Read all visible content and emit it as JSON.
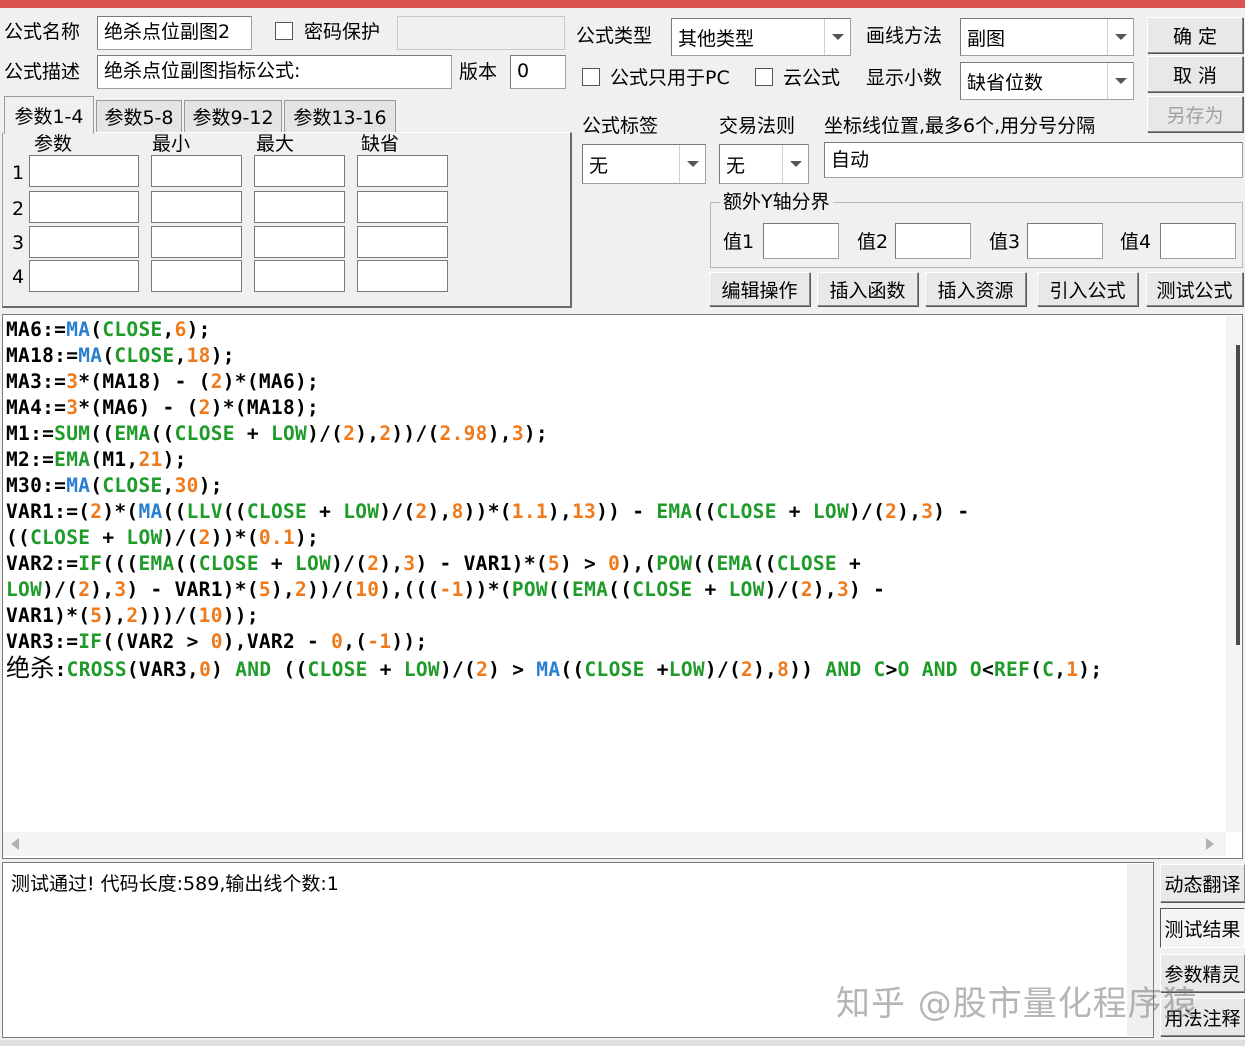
{
  "header": {
    "formula_name_label": "公式名称",
    "formula_name_value": "绝杀点位副图2",
    "password_label": "密码保护",
    "formula_type_label": "公式类型",
    "formula_type_value": "其他类型",
    "draw_method_label": "画线方法",
    "draw_method_value": "副图",
    "formula_desc_label": "公式描述",
    "formula_desc_value": "绝杀点位副图指标公式:",
    "version_label": "版本",
    "version_value": "0",
    "pc_only_label": "公式只用于PC",
    "cloud_label": "云公式",
    "decimals_label": "显示小数",
    "decimals_value": "缺省位数"
  },
  "buttons": {
    "ok": "确 定",
    "cancel": "取 消",
    "save_as": "另存为",
    "edit_ops": "编辑操作",
    "insert_func": "插入函数",
    "insert_resource": "插入资源",
    "import_formula": "引入公式",
    "test_formula": "测试公式"
  },
  "tabs": [
    "参数1-4",
    "参数5-8",
    "参数9-12",
    "参数13-16"
  ],
  "params": {
    "headers": [
      "参数",
      "最小",
      "最大",
      "缺省"
    ],
    "rows": [
      "1",
      "2",
      "3",
      "4"
    ]
  },
  "tags": {
    "formula_tag_label": "公式标签",
    "formula_tag_value": "无",
    "trade_rule_label": "交易法则",
    "trade_rule_value": "无",
    "axis_label": "坐标线位置,最多6个,用分号分隔",
    "axis_value": "自动"
  },
  "yaxis": {
    "group_label": "额外Y轴分界",
    "labels": [
      "值1",
      "值2",
      "值3",
      "值4"
    ]
  },
  "code_lines": [
    [
      [
        "k",
        "MA6:="
      ],
      [
        "m",
        "MA"
      ],
      [
        "k",
        "("
      ],
      [
        "f",
        "CLOSE"
      ],
      [
        "k",
        ","
      ],
      [
        "n",
        "6"
      ],
      [
        "k",
        ");"
      ]
    ],
    [
      [
        "k",
        "MA18:="
      ],
      [
        "m",
        "MA"
      ],
      [
        "k",
        "("
      ],
      [
        "f",
        "CLOSE"
      ],
      [
        "k",
        ","
      ],
      [
        "n",
        "18"
      ],
      [
        "k",
        ");"
      ]
    ],
    [
      [
        "k",
        "MA3:="
      ],
      [
        "n",
        "3"
      ],
      [
        "k",
        "*(MA18) - ("
      ],
      [
        "n",
        "2"
      ],
      [
        "k",
        ")*(MA6);"
      ]
    ],
    [
      [
        "k",
        "MA4:="
      ],
      [
        "n",
        "3"
      ],
      [
        "k",
        "*(MA6) - ("
      ],
      [
        "n",
        "2"
      ],
      [
        "k",
        ")*(MA18);"
      ]
    ],
    [
      [
        "k",
        "M1:="
      ],
      [
        "f",
        "SUM"
      ],
      [
        "k",
        "(("
      ],
      [
        "f",
        "EMA"
      ],
      [
        "k",
        "(("
      ],
      [
        "f",
        "CLOSE"
      ],
      [
        "k",
        " + "
      ],
      [
        "f",
        "LOW"
      ],
      [
        "k",
        ")/("
      ],
      [
        "n",
        "2"
      ],
      [
        "k",
        "),"
      ],
      [
        "n",
        "2"
      ],
      [
        "k",
        "))/("
      ],
      [
        "n",
        "2.98"
      ],
      [
        "k",
        "),"
      ],
      [
        "n",
        "3"
      ],
      [
        "k",
        ");"
      ]
    ],
    [
      [
        "k",
        "M2:="
      ],
      [
        "f",
        "EMA"
      ],
      [
        "k",
        "(M1,"
      ],
      [
        "n",
        "21"
      ],
      [
        "k",
        ");"
      ]
    ],
    [
      [
        "k",
        "M30:="
      ],
      [
        "m",
        "MA"
      ],
      [
        "k",
        "("
      ],
      [
        "f",
        "CLOSE"
      ],
      [
        "k",
        ","
      ],
      [
        "n",
        "30"
      ],
      [
        "k",
        ");"
      ]
    ],
    [
      [
        "k",
        "VAR1:=("
      ],
      [
        "n",
        "2"
      ],
      [
        "k",
        ")*("
      ],
      [
        "m",
        "MA"
      ],
      [
        "k",
        "(("
      ],
      [
        "f",
        "LLV"
      ],
      [
        "k",
        "(("
      ],
      [
        "f",
        "CLOSE"
      ],
      [
        "k",
        " + "
      ],
      [
        "f",
        "LOW"
      ],
      [
        "k",
        ")/("
      ],
      [
        "n",
        "2"
      ],
      [
        "k",
        "),"
      ],
      [
        "n",
        "8"
      ],
      [
        "k",
        "))*("
      ],
      [
        "n",
        "1.1"
      ],
      [
        "k",
        "),"
      ],
      [
        "n",
        "13"
      ],
      [
        "k",
        ")) - "
      ],
      [
        "f",
        "EMA"
      ],
      [
        "k",
        "(("
      ],
      [
        "f",
        "CLOSE"
      ],
      [
        "k",
        " + "
      ],
      [
        "f",
        "LOW"
      ],
      [
        "k",
        ")/("
      ],
      [
        "n",
        "2"
      ],
      [
        "k",
        "),"
      ],
      [
        "n",
        "3"
      ],
      [
        "k",
        ") -"
      ]
    ],
    [
      [
        "k",
        "(("
      ],
      [
        "f",
        "CLOSE"
      ],
      [
        "k",
        " + "
      ],
      [
        "f",
        "LOW"
      ],
      [
        "k",
        ")/("
      ],
      [
        "n",
        "2"
      ],
      [
        "k",
        "))*("
      ],
      [
        "n",
        "0.1"
      ],
      [
        "k",
        ");"
      ]
    ],
    [
      [
        "k",
        "VAR2:="
      ],
      [
        "f",
        "IF"
      ],
      [
        "k",
        "((("
      ],
      [
        "f",
        "EMA"
      ],
      [
        "k",
        "(("
      ],
      [
        "f",
        "CLOSE"
      ],
      [
        "k",
        " + "
      ],
      [
        "f",
        "LOW"
      ],
      [
        "k",
        ")/("
      ],
      [
        "n",
        "2"
      ],
      [
        "k",
        "),"
      ],
      [
        "n",
        "3"
      ],
      [
        "k",
        ") - VAR1)*("
      ],
      [
        "n",
        "5"
      ],
      [
        "k",
        ") > "
      ],
      [
        "n",
        "0"
      ],
      [
        "k",
        "),("
      ],
      [
        "f",
        "POW"
      ],
      [
        "k",
        "(("
      ],
      [
        "f",
        "EMA"
      ],
      [
        "k",
        "(("
      ],
      [
        "f",
        "CLOSE"
      ],
      [
        "k",
        " +"
      ]
    ],
    [
      [
        "f",
        "LOW"
      ],
      [
        "k",
        ")/("
      ],
      [
        "n",
        "2"
      ],
      [
        "k",
        "),"
      ],
      [
        "n",
        "3"
      ],
      [
        "k",
        ") - VAR1)*("
      ],
      [
        "n",
        "5"
      ],
      [
        "k",
        "),"
      ],
      [
        "n",
        "2"
      ],
      [
        "k",
        "))/("
      ],
      [
        "n",
        "10"
      ],
      [
        "k",
        "),((("
      ],
      [
        "n",
        "-1"
      ],
      [
        "k",
        "))*("
      ],
      [
        "f",
        "POW"
      ],
      [
        "k",
        "(("
      ],
      [
        "f",
        "EMA"
      ],
      [
        "k",
        "(("
      ],
      [
        "f",
        "CLOSE"
      ],
      [
        "k",
        " + "
      ],
      [
        "f",
        "LOW"
      ],
      [
        "k",
        ")/("
      ],
      [
        "n",
        "2"
      ],
      [
        "k",
        "),"
      ],
      [
        "n",
        "3"
      ],
      [
        "k",
        ") -"
      ]
    ],
    [
      [
        "k",
        "VAR1)*("
      ],
      [
        "n",
        "5"
      ],
      [
        "k",
        "),"
      ],
      [
        "n",
        "2"
      ],
      [
        "k",
        ")))/("
      ],
      [
        "n",
        "10"
      ],
      [
        "k",
        "));"
      ]
    ],
    [
      [
        "k",
        "VAR3:="
      ],
      [
        "f",
        "IF"
      ],
      [
        "k",
        "((VAR2 > "
      ],
      [
        "n",
        "0"
      ],
      [
        "k",
        "),VAR2 - "
      ],
      [
        "n",
        "0"
      ],
      [
        "k",
        ",("
      ],
      [
        "n",
        "-1"
      ],
      [
        "k",
        "));"
      ]
    ],
    [
      [
        "cn",
        "绝杀"
      ],
      [
        "k",
        ":"
      ],
      [
        "f",
        "CROSS"
      ],
      [
        "k",
        "(VAR3,"
      ],
      [
        "n",
        "0"
      ],
      [
        "k",
        ") "
      ],
      [
        "f",
        "AND"
      ],
      [
        "k",
        " (("
      ],
      [
        "f",
        "CLOSE"
      ],
      [
        "k",
        " + "
      ],
      [
        "f",
        "LOW"
      ],
      [
        "k",
        ")/("
      ],
      [
        "n",
        "2"
      ],
      [
        "k",
        ") > "
      ],
      [
        "m",
        "MA"
      ],
      [
        "k",
        "(("
      ],
      [
        "f",
        "CLOSE"
      ],
      [
        "k",
        " +"
      ],
      [
        "f",
        "LOW"
      ],
      [
        "k",
        ")/("
      ],
      [
        "n",
        "2"
      ],
      [
        "k",
        "),"
      ],
      [
        "n",
        "8"
      ],
      [
        "k",
        "))"
      ],
      [
        "k",
        " "
      ],
      [
        "f",
        "AND"
      ],
      [
        "k",
        " "
      ],
      [
        "f",
        "C"
      ],
      [
        "k",
        ">"
      ],
      [
        "f",
        "O"
      ],
      [
        "k",
        " "
      ],
      [
        "f",
        "AND"
      ],
      [
        "k",
        " "
      ],
      [
        "f",
        "O"
      ],
      [
        "k",
        "<"
      ],
      [
        "f",
        "REF"
      ],
      [
        "k",
        "("
      ],
      [
        "f",
        "C"
      ],
      [
        "k",
        ","
      ],
      [
        "n",
        "1"
      ],
      [
        "k",
        ");"
      ]
    ]
  ],
  "output_text": "测试通过! 代码长度:589,输出线个数:1",
  "side_buttons": [
    "动态翻译",
    "测试结果",
    "参数精灵",
    "用法注释"
  ],
  "watermark": "知乎 @股市量化程序猿",
  "colors": {
    "function": "#1f9b2a",
    "ma": "#2a7fd0",
    "number": "#f07a1a",
    "title_bar": "#d9534f"
  }
}
